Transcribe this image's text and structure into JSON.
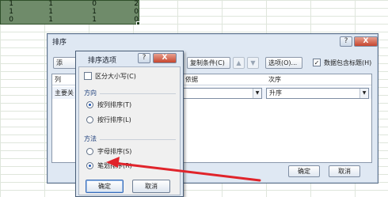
{
  "sheet": {
    "rows": [
      [
        "1",
        "1",
        "0",
        "2"
      ],
      [
        "1",
        "1",
        "1",
        "0"
      ],
      [
        "0",
        "1",
        "1",
        "0"
      ]
    ]
  },
  "sort_dialog": {
    "title": "排序",
    "help_label": "?",
    "close_label": "X",
    "add_level_label": "添",
    "copy_level_label": "复制条件(C)",
    "move_up_label": "▲",
    "move_down_label": "▼",
    "options_label": "选项(O)...",
    "header_checkbox_label": "数据包含标题(H)",
    "header_checkbox_checked": "✓",
    "col_header": "列",
    "sort_on_header": "依据",
    "order_header": "次序",
    "row_key": "主要关",
    "order_value": "升序",
    "ok_label": "确定",
    "cancel_label": "取消"
  },
  "options_dialog": {
    "title": "排序选项",
    "help_label": "?",
    "close_label": "X",
    "case_sensitive_label": "区分大小写(C)",
    "orientation_group": "方向",
    "sort_top_to_bottom": "按列排序(T)",
    "sort_left_to_right": "按行排序(L)",
    "method_group": "方法",
    "letter_sort": "字母排序(S)",
    "stroke_sort": "笔划排序(R)",
    "ok_label": "确定",
    "cancel_label": "取消",
    "selected_orientation": "sort_top_to_bottom",
    "selected_method": "stroke_sort"
  },
  "colors": {
    "selection_fill": "#6f8b6a",
    "dialog_bg": "#dfe8f3",
    "annotation_arrow": "#e0242b"
  }
}
